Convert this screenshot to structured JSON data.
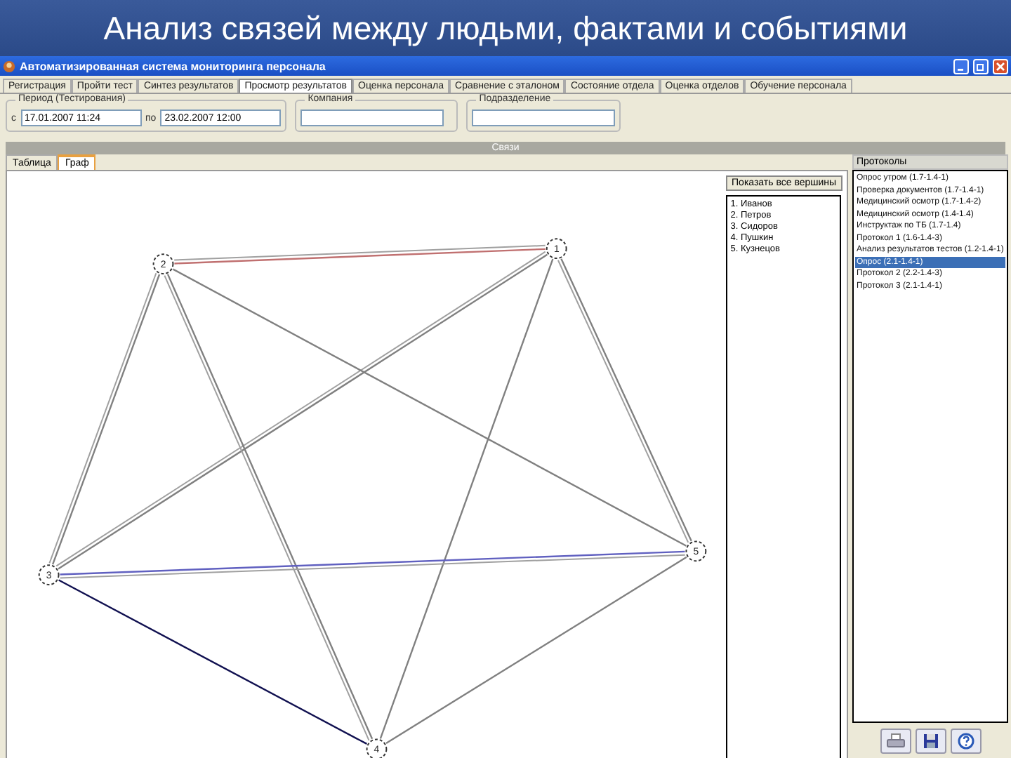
{
  "slide": {
    "title": "Анализ связей между людьми, фактами и событиями"
  },
  "window": {
    "title": "Автоматизированная система мониторинга персонала"
  },
  "tabs": [
    {
      "label": "Регистрация",
      "selected": false
    },
    {
      "label": "Пройти тест",
      "selected": false
    },
    {
      "label": "Синтез результатов",
      "selected": false
    },
    {
      "label": "Просмотр результатов",
      "selected": true
    },
    {
      "label": "Оценка персонала",
      "selected": false
    },
    {
      "label": "Сравнение с эталоном",
      "selected": false
    },
    {
      "label": "Состояние отдела",
      "selected": false
    },
    {
      "label": "Оценка отделов",
      "selected": false
    },
    {
      "label": "Обучение персонала",
      "selected": false
    }
  ],
  "filters": {
    "period_label": "Период (Тестирования)",
    "from_label": "с",
    "from": "17.01.2007 11:24",
    "to_label": "по",
    "to": "23.02.2007 12:00",
    "company_label": "Компания",
    "department_label": "Подразделение"
  },
  "panel": {
    "title": "Связи"
  },
  "view_tabs": [
    {
      "label": "Таблица",
      "selected": false
    },
    {
      "label": "Граф",
      "selected": true
    }
  ],
  "graph": {
    "nodes": [
      {
        "label": "1"
      },
      {
        "label": "2"
      },
      {
        "label": "3"
      },
      {
        "label": "4"
      },
      {
        "label": "5"
      }
    ],
    "edges": [
      {
        "color": "#c07070",
        "double": true
      },
      {
        "color": "#808080",
        "double": true
      },
      {
        "color": "#808080",
        "double": false
      },
      {
        "color": "#808080",
        "double": true
      },
      {
        "color": "#808080",
        "double": true
      },
      {
        "color": "#808080",
        "double": true
      },
      {
        "color": "#808080",
        "double": false
      },
      {
        "color": "#6060c0",
        "double": true
      },
      {
        "color": "#101050",
        "double": false
      },
      {
        "color": "#808080",
        "double": false
      }
    ]
  },
  "legend": {
    "button": "Показать все вершины",
    "items": [
      "1. Иванов",
      "2. Петров",
      "3. Сидоров",
      "4. Пушкин",
      "5. Кузнецов"
    ]
  },
  "protocols": {
    "title": "Протоколы",
    "items": [
      {
        "label": "Опрос утром (1.7-1.4-1)",
        "selected": false
      },
      {
        "label": "Проверка документов (1.7-1.4-1)",
        "selected": false
      },
      {
        "label": "Медицинский осмотр (1.7-1.4-2)",
        "selected": false
      },
      {
        "label": "Медицинский осмотр (1.4-1.4)",
        "selected": false
      },
      {
        "label": "Инструктаж по ТБ (1.7-1.4)",
        "selected": false
      },
      {
        "label": "Протокол 1 (1.6-1.4-3)",
        "selected": false
      },
      {
        "label": "Анализ результатов тестов (1.2-1.4-1)",
        "selected": false
      },
      {
        "label": "Опрос (2.1-1.4-1)",
        "selected": true
      },
      {
        "label": "Протокол 2 (2.2-1.4-3)",
        "selected": false
      },
      {
        "label": "Протокол 3 (2.1-1.4-1)",
        "selected": false
      }
    ]
  }
}
